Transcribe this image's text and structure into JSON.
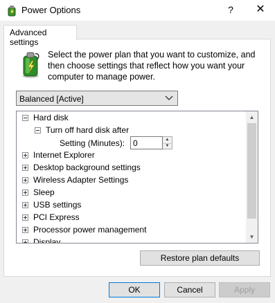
{
  "window": {
    "title": "Power Options",
    "help_glyph": "?",
    "close_glyph": "✕"
  },
  "tabs": [
    {
      "label": "Advanced settings"
    }
  ],
  "description": "Select the power plan that you want to customize, and then choose settings that reflect how you want your computer to manage power.",
  "plan_select": {
    "value": "Balanced [Active]"
  },
  "tree": {
    "items": [
      {
        "label": "Hard disk",
        "expanded": true
      },
      {
        "label": "Turn off hard disk after",
        "expanded": true
      },
      {
        "label": "Internet Explorer",
        "expanded": false
      },
      {
        "label": "Desktop background settings",
        "expanded": false
      },
      {
        "label": "Wireless Adapter Settings",
        "expanded": false
      },
      {
        "label": "Sleep",
        "expanded": false
      },
      {
        "label": "USB settings",
        "expanded": false
      },
      {
        "label": "PCI Express",
        "expanded": false
      },
      {
        "label": "Processor power management",
        "expanded": false
      },
      {
        "label": "Display",
        "expanded": false
      }
    ],
    "setting": {
      "label": "Setting (Minutes):",
      "value": "0"
    }
  },
  "buttons": {
    "restore": "Restore plan defaults",
    "ok": "OK",
    "cancel": "Cancel",
    "apply": "Apply"
  },
  "icons": {
    "app": "power-options-icon",
    "battery": "battery-plan-icon"
  }
}
